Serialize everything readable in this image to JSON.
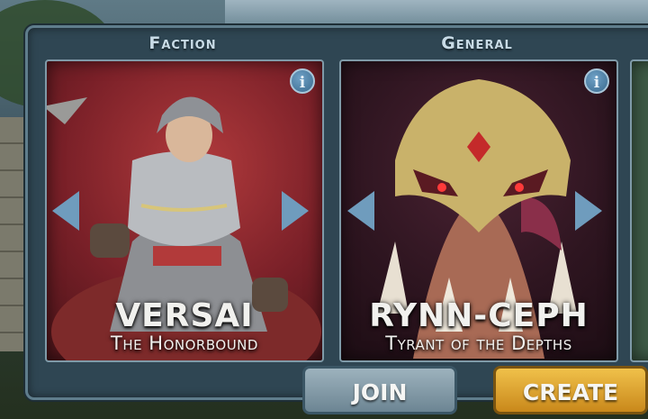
{
  "screen": {
    "faction_title": "Faction",
    "general_title": "General"
  },
  "faction_card": {
    "name": "VERSAI",
    "subtitle": "The Honorbound",
    "info_label": "i"
  },
  "general_card": {
    "name": "RYNN-CEPH",
    "subtitle": "Tyrant of the Depths",
    "info_label": "i"
  },
  "buttons": {
    "join_label": "JOIN",
    "create_label": "CREATE"
  },
  "colors": {
    "panel": "#2f4653",
    "arrow": "#6f9cbd",
    "create_button": "#e0a834",
    "join_button": "#8ea3ae"
  }
}
